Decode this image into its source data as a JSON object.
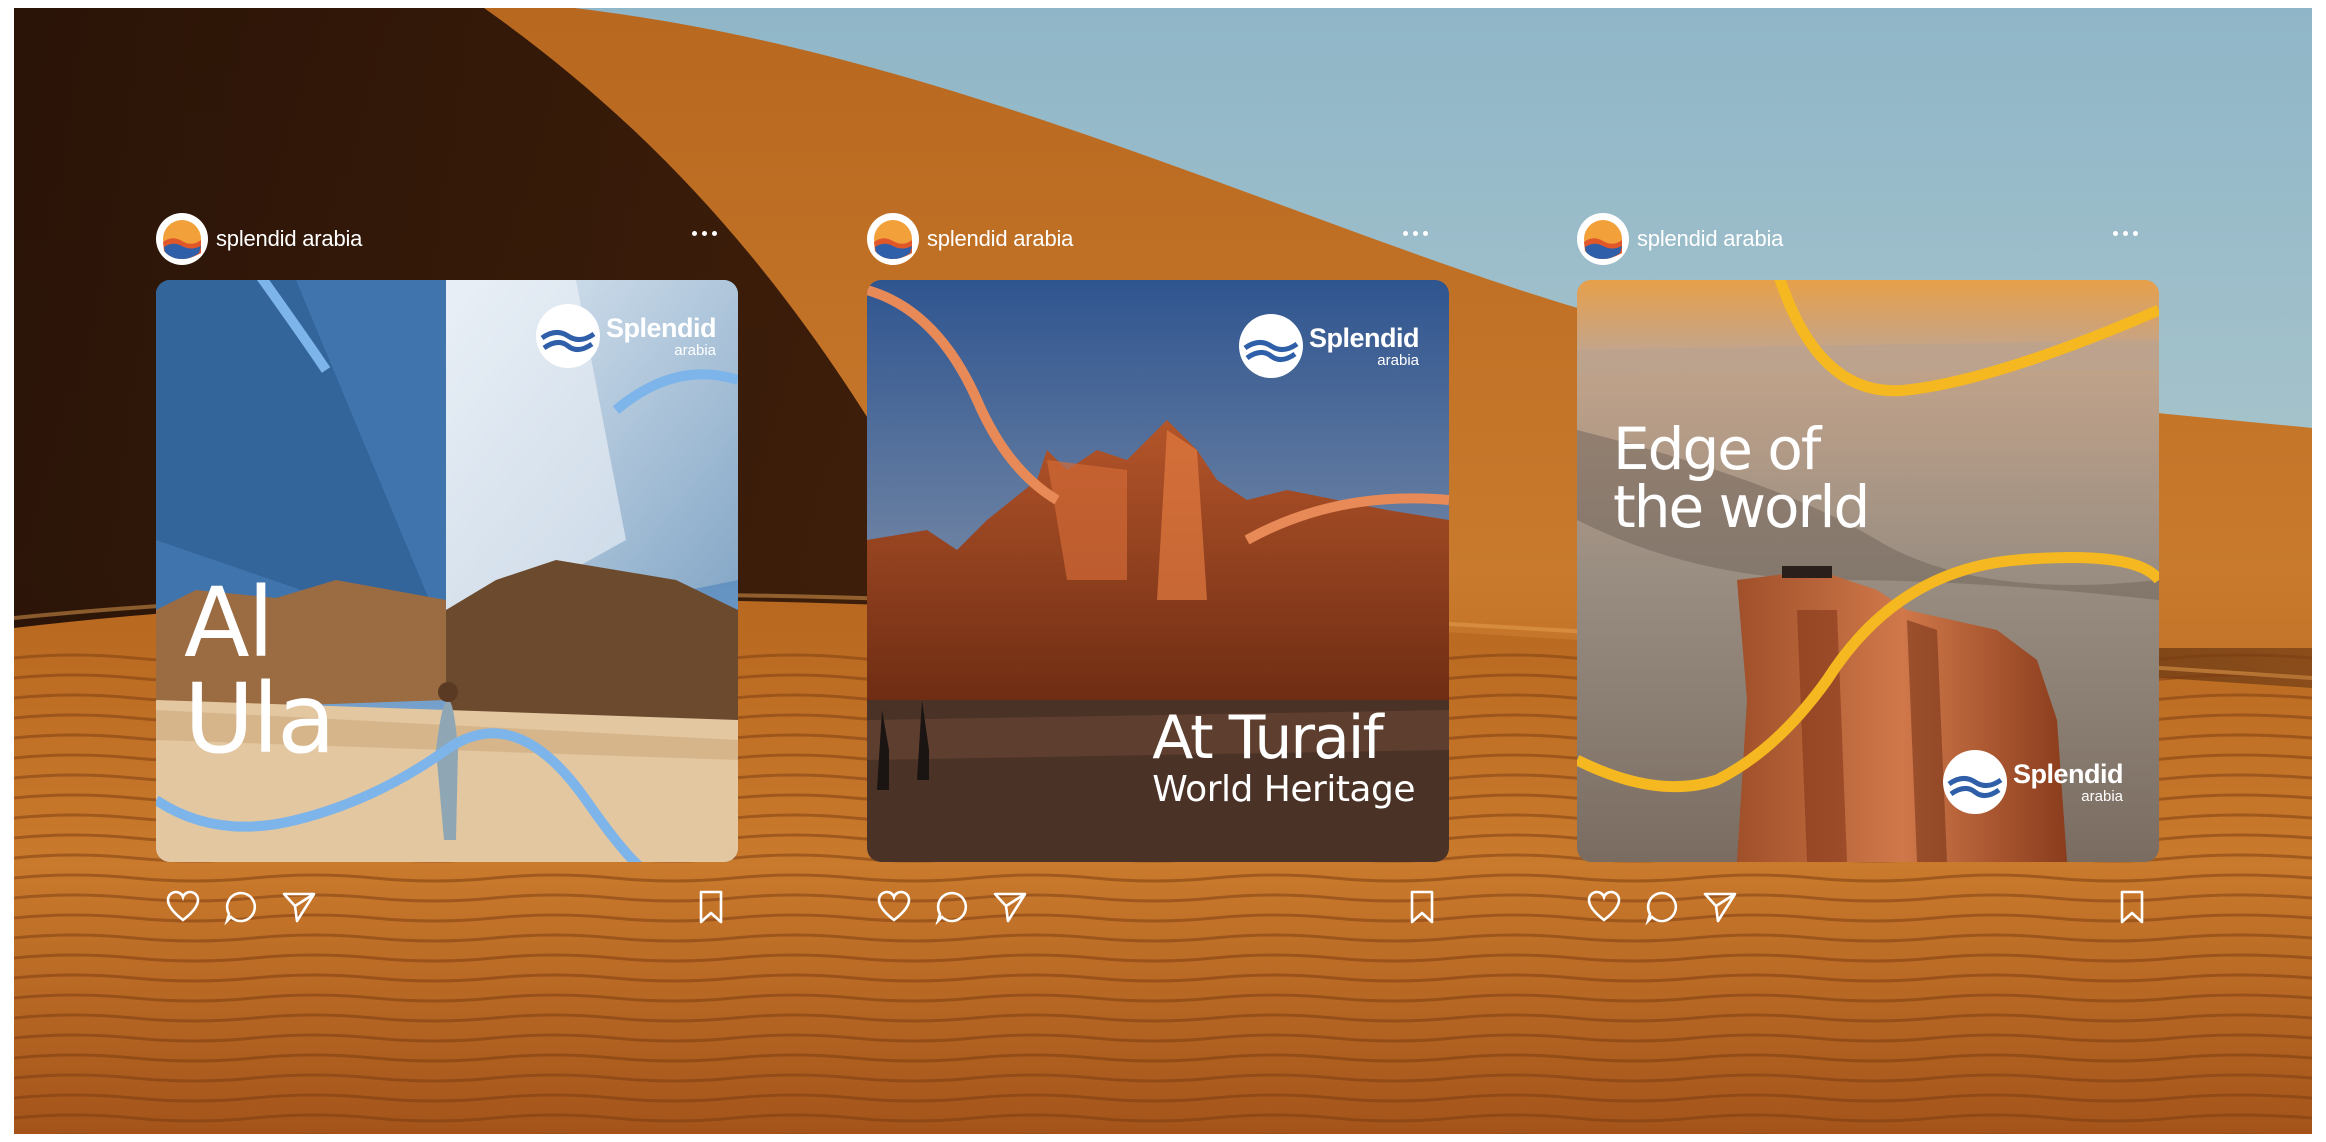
{
  "account": {
    "handle": "splendid arabia"
  },
  "brand": {
    "name": "Splendid",
    "sub": "arabia"
  },
  "posts": [
    {
      "headline_line1": "Al",
      "headline_line2": "Ula",
      "accent": "#7db4ea"
    },
    {
      "headline_line1": "At Turaif",
      "headline_line2": "World Heritage",
      "accent": "#e88a57"
    },
    {
      "headline_line1": "Edge of",
      "headline_line2": "the world",
      "accent": "#f5b820"
    }
  ],
  "icons": [
    "heart-icon",
    "comment-icon",
    "share-icon",
    "bookmark-icon",
    "more-icon"
  ],
  "colors": {
    "sand": "#c9772a",
    "sky": "#9fc2cf",
    "shadow": "#1f0d05"
  }
}
